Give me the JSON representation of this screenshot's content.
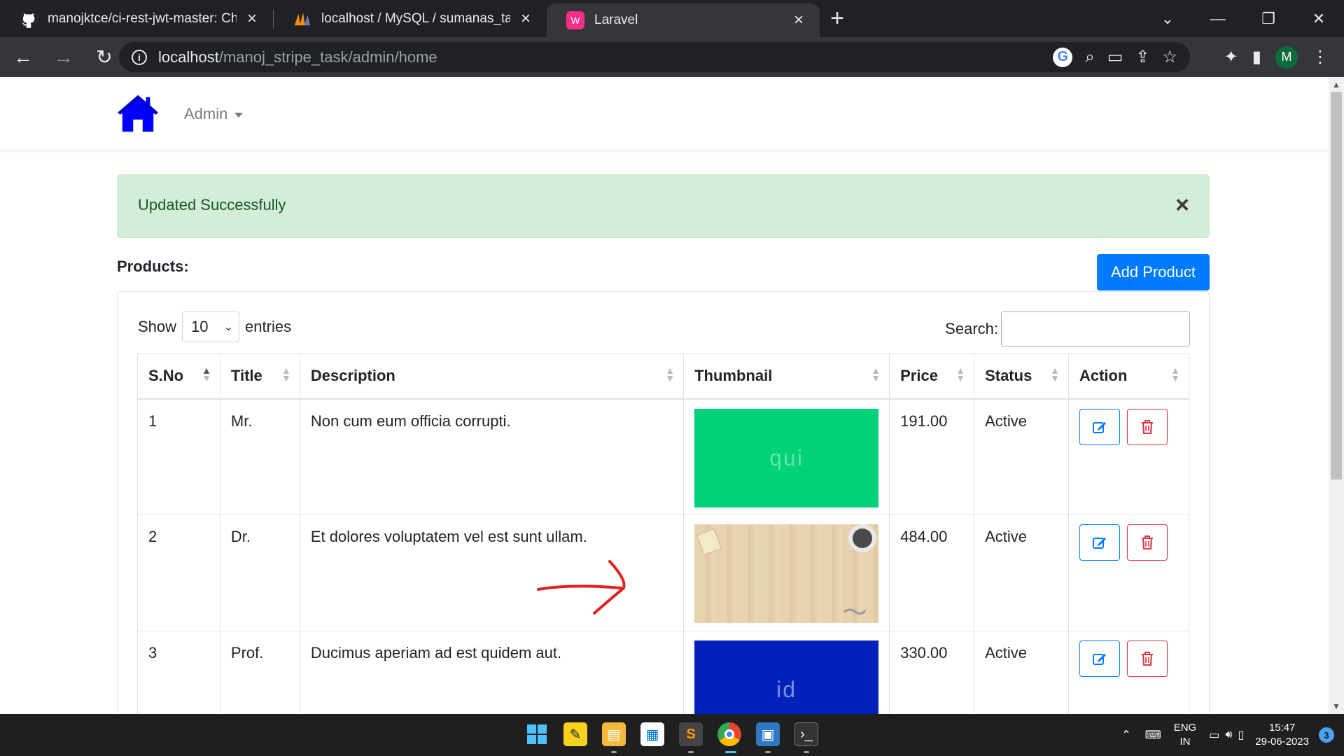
{
  "browser": {
    "tabs": [
      {
        "title": "manojktce/ci-rest-jwt-master: Ch",
        "icon": "github-icon"
      },
      {
        "title": "localhost / MySQL / sumanas_tas",
        "icon": "phpmyadmin-icon"
      },
      {
        "title": "Laravel",
        "icon": "laravel-icon"
      }
    ],
    "url_host": "localhost",
    "url_path": "/manoj_stripe_task/admin/home",
    "profile_initial": "M"
  },
  "nav": {
    "admin_label": "Admin"
  },
  "alert": {
    "message": "Updated Successfully",
    "close": "×"
  },
  "products": {
    "heading": "Products:",
    "add_button": "Add Product"
  },
  "datatable": {
    "show_label": "Show",
    "page_length": "10",
    "entries_label": "entries",
    "search_label": "Search:",
    "columns": [
      "S.No",
      "Title",
      "Description",
      "Thumbnail",
      "Price",
      "Status",
      "Action"
    ],
    "rows": [
      {
        "sno": "1",
        "title": "Mr.",
        "description": "Non cum eum officia corrupti.",
        "thumb_text": "qui",
        "thumb_color": "#00d27a",
        "price": "191.00",
        "status": "Active"
      },
      {
        "sno": "2",
        "title": "Dr.",
        "description": "Et dolores voluptatem vel est sunt ullam.",
        "thumb_text": "",
        "thumb_color": "#e8d3b0",
        "price": "484.00",
        "status": "Active"
      },
      {
        "sno": "3",
        "title": "Prof.",
        "description": "Ducimus aperiam ad est quidem aut.",
        "thumb_text": "id",
        "thumb_color": "#0022bb",
        "price": "330.00",
        "status": "Active"
      }
    ]
  },
  "taskbar": {
    "lang_top": "ENG",
    "lang_bottom": "IN",
    "time": "15:47",
    "date": "29-06-2023",
    "notifications": "3"
  },
  "colors": {
    "primary": "#007bff",
    "danger": "#dc3545",
    "success_bg": "#d4edda",
    "success_text": "#155724",
    "home_icon": "#0000ff"
  }
}
